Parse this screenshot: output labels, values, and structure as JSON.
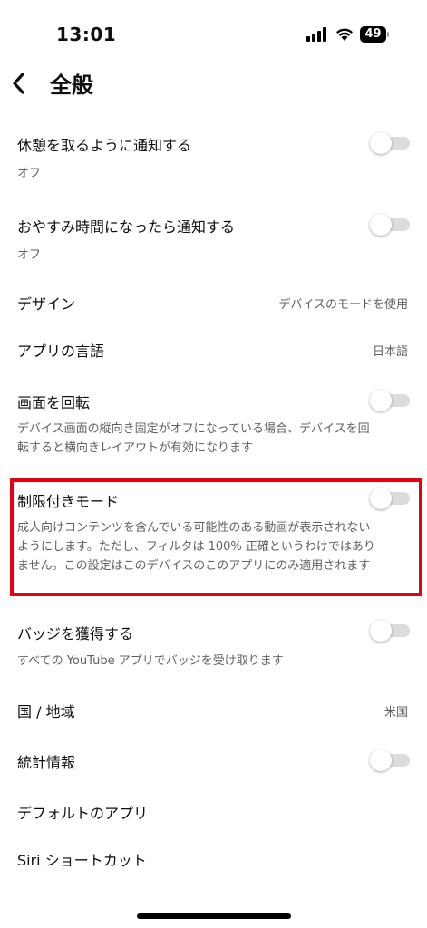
{
  "status_bar": {
    "time": "13:01",
    "battery": "49"
  },
  "header": {
    "title": "全般"
  },
  "settings": [
    {
      "label": "休憩を取るように通知する",
      "sub": "オフ"
    },
    {
      "label": "おやすみ時間になったら通知する",
      "sub": "オフ"
    },
    {
      "label": "デザイン",
      "value": "デバイスのモードを使用"
    },
    {
      "label": "アプリの言語",
      "value": "日本語"
    },
    {
      "label": "画面を回転",
      "sub": "デバイス画面の縦向き固定がオフになっている場合、デバイスを回転すると横向きレイアウトが有効になります"
    },
    {
      "label": "制限付きモード",
      "sub": "成人向けコンテンツを含んでいる可能性のある動画が表示されないようにします。ただし、フィルタは 100% 正確というわけではありません。この設定はこのデバイスのこのアプリにのみ適用されます"
    },
    {
      "label": "バッジを獲得する",
      "sub": "すべての YouTube アプリでバッジを受け取ります"
    },
    {
      "label": "国 / 地域",
      "value": "米国"
    },
    {
      "label": "統計情報"
    },
    {
      "label": "デフォルトのアプリ"
    },
    {
      "label": "Siri ショートカット"
    }
  ],
  "colors": {
    "highlight": "#e60012",
    "toggle_off_track": "#dcdcdc"
  }
}
